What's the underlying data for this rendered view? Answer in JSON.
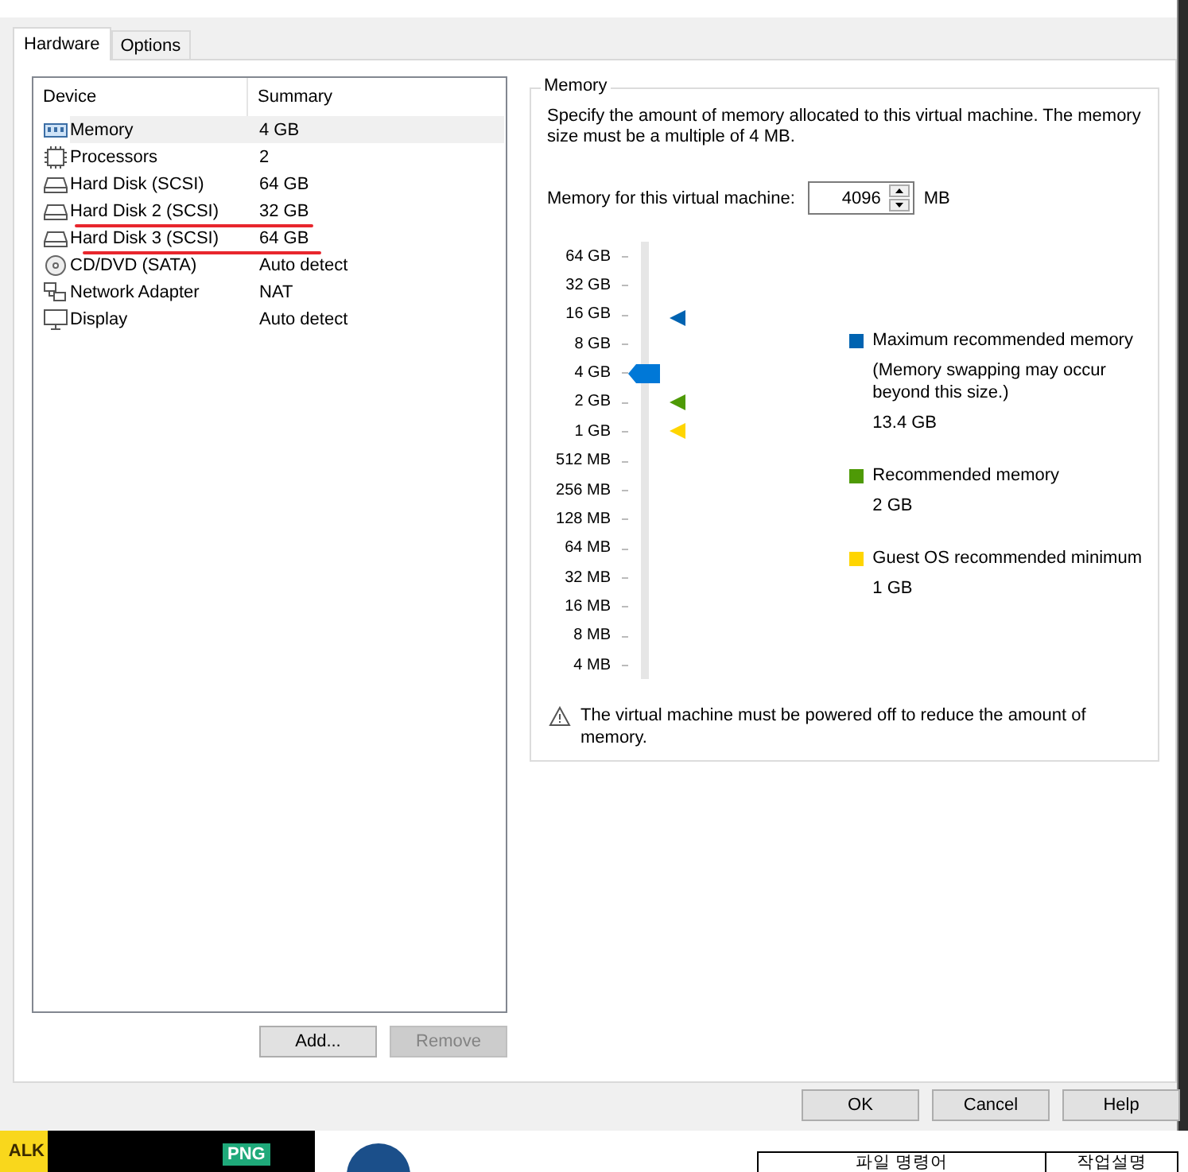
{
  "tabs": [
    {
      "label": "Hardware",
      "selected": true
    },
    {
      "label": "Options",
      "selected": false
    }
  ],
  "device_list": {
    "columns": [
      "Device",
      "Summary"
    ],
    "rows": [
      {
        "kind": "memory",
        "name": "Memory",
        "summary": "4 GB",
        "selected": true,
        "annotated": false
      },
      {
        "kind": "processor",
        "name": "Processors",
        "summary": "2",
        "selected": false,
        "annotated": false
      },
      {
        "kind": "disk",
        "name": "Hard Disk (SCSI)",
        "summary": "64 GB",
        "selected": false,
        "annotated": false
      },
      {
        "kind": "disk",
        "name": "Hard Disk 2 (SCSI)",
        "summary": "32 GB",
        "selected": false,
        "annotated": true
      },
      {
        "kind": "disk",
        "name": "Hard Disk 3 (SCSI)",
        "summary": "64 GB",
        "selected": false,
        "annotated": true
      },
      {
        "kind": "optical",
        "name": "CD/DVD (SATA)",
        "summary": "Auto detect",
        "selected": false,
        "annotated": false
      },
      {
        "kind": "network",
        "name": "Network Adapter",
        "summary": "NAT",
        "selected": false,
        "annotated": false
      },
      {
        "kind": "display",
        "name": "Display",
        "summary": "Auto detect",
        "selected": false,
        "annotated": false
      }
    ]
  },
  "device_buttons": [
    {
      "label": "Add...",
      "disabled": false
    },
    {
      "label": "Remove",
      "disabled": true
    }
  ],
  "memory": {
    "title": "Memory",
    "description": "Specify the amount of memory allocated to this virtual machine. The memory size must be a multiple of 4 MB.",
    "field_label": "Memory for this virtual machine:",
    "value": "4096",
    "unit": "MB",
    "slider": {
      "ticks": [
        "64 GB",
        "32 GB",
        "16 GB",
        "8 GB",
        "4 GB",
        "2 GB",
        "1 GB",
        "512 MB",
        "256 MB",
        "128 MB",
        "64 MB",
        "32 MB",
        "16 MB",
        "8 MB",
        "4 MB"
      ],
      "level": 0.714,
      "markers": [
        {
          "color": "#0063b1",
          "level": 0.85
        },
        {
          "color": "#4e9a06",
          "level": 0.643
        },
        {
          "color": "#ffd500",
          "level": 0.571
        }
      ]
    },
    "legend": [
      {
        "color": "#0063b1",
        "title": "Maximum recommended memory",
        "note": "(Memory swapping may occur beyond this size.)",
        "value": "13.4 GB"
      },
      {
        "color": "#4e9a06",
        "title": "Recommended memory",
        "value": "2 GB"
      },
      {
        "color": "#ffd500",
        "title": "Guest OS recommended minimum",
        "value": "1 GB"
      }
    ],
    "warning": "The virtual machine must be powered off to reduce the amount of memory."
  },
  "dialog_buttons": [
    "OK",
    "Cancel",
    "Help"
  ],
  "desktop": {
    "app_label": "ALK",
    "badge": "PNG",
    "table_cells": [
      "파일 명령어",
      "작업설명"
    ]
  }
}
